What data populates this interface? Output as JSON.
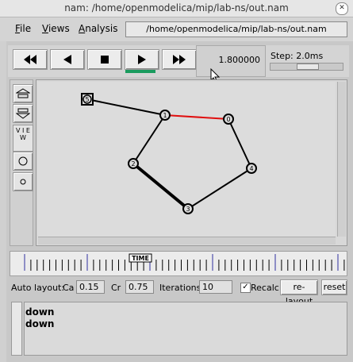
{
  "window": {
    "title": "nam: /home/openmodelica/mip/lab-ns/out.nam"
  },
  "menu": {
    "file": {
      "underline": "F",
      "rest": "ile"
    },
    "views": {
      "underline": "V",
      "rest": "iews"
    },
    "analysis": {
      "underline": "A",
      "rest": "nalysis"
    }
  },
  "path": "/home/openmodelica/mip/lab-ns/out.nam",
  "controls": {
    "rewind": "rewind-icon",
    "back": "step-back-icon",
    "stop": "stop-icon",
    "play": "play-icon",
    "fastforward": "fast-forward-icon",
    "active_color": "#1a9b5e"
  },
  "time_value": "1.800000",
  "step_label": "Step: 2.0ms",
  "step_position": 0.45,
  "tools": {
    "view_label": "V I E W"
  },
  "network": {
    "nodes": [
      {
        "id": "5",
        "shape": "square"
      },
      {
        "id": "1",
        "shape": "circle"
      },
      {
        "id": "0",
        "shape": "circle"
      },
      {
        "id": "2",
        "shape": "circle"
      },
      {
        "id": "4",
        "shape": "circle"
      },
      {
        "id": "3",
        "shape": "circle"
      }
    ],
    "links": [
      {
        "from": "5",
        "to": "1",
        "color": "#000000"
      },
      {
        "from": "1",
        "to": "0",
        "color": "#e01010"
      },
      {
        "from": "1",
        "to": "2",
        "color": "#000000"
      },
      {
        "from": "0",
        "to": "4",
        "color": "#000000"
      },
      {
        "from": "2",
        "to": "3",
        "color": "#000000"
      },
      {
        "from": "4",
        "to": "3",
        "color": "#000000"
      }
    ]
  },
  "timeline": {
    "label": "TIME"
  },
  "layout": {
    "auto_label": "Auto layout:",
    "ca_label": "Ca",
    "ca_value": "0.15",
    "cr_label": "Cr",
    "cr_value": "0.75",
    "iter_label": "Iterations",
    "iter_value": "10",
    "recalc_label": "Recalc",
    "recalc_checked": true,
    "relayout_label": "re-layout",
    "reset_label": "reset"
  },
  "log": [
    "down",
    "down"
  ]
}
